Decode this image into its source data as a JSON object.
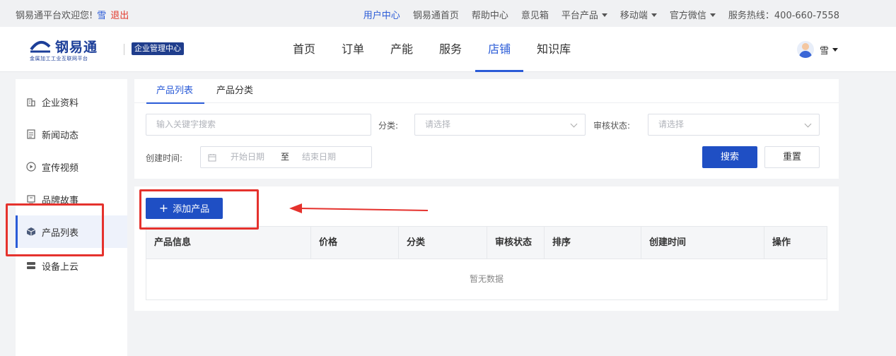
{
  "topbar": {
    "welcome": "钢易通平台欢迎您!",
    "username": "雪",
    "logout": "退出",
    "links": [
      {
        "label": "用户中心",
        "active": true,
        "dropdown": false
      },
      {
        "label": "钢易通首页",
        "active": false,
        "dropdown": false
      },
      {
        "label": "帮助中心",
        "active": false,
        "dropdown": false
      },
      {
        "label": "意见箱",
        "active": false,
        "dropdown": false
      },
      {
        "label": "平台产品",
        "active": false,
        "dropdown": true
      },
      {
        "label": "移动端",
        "active": false,
        "dropdown": true
      },
      {
        "label": "官方微信",
        "active": false,
        "dropdown": true
      },
      {
        "label": "服务热线：400-660-7558",
        "active": false,
        "dropdown": false
      }
    ]
  },
  "header": {
    "logo_name": "钢易通",
    "logo_sub": "金属加工工业互联网平台",
    "badge": "企业管理中心",
    "nav": [
      {
        "label": "首页",
        "active": false
      },
      {
        "label": "订单",
        "active": false
      },
      {
        "label": "产能",
        "active": false
      },
      {
        "label": "服务",
        "active": false
      },
      {
        "label": "店铺",
        "active": true
      },
      {
        "label": "知识库",
        "active": false
      }
    ],
    "account_name": "雪"
  },
  "sidebar": {
    "items": [
      {
        "label": "企业资料",
        "icon": "building-icon",
        "active": false
      },
      {
        "label": "新闻动态",
        "icon": "document-icon",
        "active": false
      },
      {
        "label": "宣传视频",
        "icon": "play-icon",
        "active": false
      },
      {
        "label": "品牌故事",
        "icon": "book-icon",
        "active": false
      },
      {
        "label": "产品列表",
        "icon": "cube-icon",
        "active": true
      },
      {
        "label": "设备上云",
        "icon": "server-icon",
        "active": false
      }
    ]
  },
  "tabs": [
    "产品列表",
    "产品分类"
  ],
  "filters": {
    "keyword_placeholder": "输入关键字搜索",
    "category_label": "分类:",
    "category_placeholder": "请选择",
    "status_label": "审核状态:",
    "status_placeholder": "请选择",
    "created_label": "创建时间:",
    "start_placeholder": "开始日期",
    "range_separator": "至",
    "end_placeholder": "结束日期",
    "search_button": "搜索",
    "reset_button": "重置"
  },
  "add_button": "添加产品",
  "table": {
    "columns": [
      "产品信息",
      "价格",
      "分类",
      "审核状态",
      "排序",
      "创建时间",
      "操作"
    ],
    "empty_text": "暂无数据"
  },
  "colors": {
    "primary": "#1f4fc4",
    "link": "#2a5bd7",
    "annotation": "#e5322d"
  }
}
